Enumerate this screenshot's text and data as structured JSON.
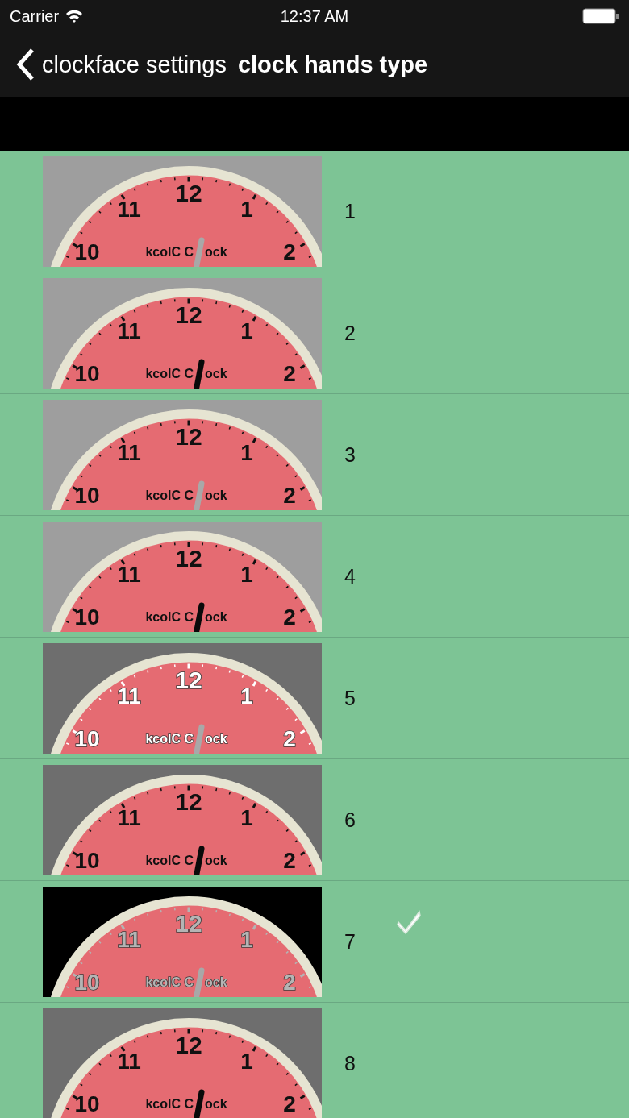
{
  "status_bar": {
    "carrier": "Carrier",
    "time": "12:37 AM"
  },
  "nav_bar": {
    "back_label": "clockface settings",
    "title": "clock hands type"
  },
  "rows": [
    {
      "label": "1",
      "selected": false,
      "color": "#9e9e9e",
      "kind": "silver",
      "numerals": {
        "color": "#111111",
        "labels": [
          "12",
          "11",
          "1",
          "10",
          "2"
        ]
      },
      "brand": [
        "kcolC C",
        "ock"
      ]
    },
    {
      "label": "2",
      "selected": false,
      "color": "#9e9e9e",
      "kind": "black",
      "numerals": {
        "color": "#111111",
        "labels": [
          "12",
          "11",
          "1",
          "10",
          "2"
        ]
      },
      "brand": [
        "kcolC C",
        "ock"
      ]
    },
    {
      "label": "3",
      "selected": false,
      "color": "#9e9e9e",
      "kind": "silver",
      "numerals": {
        "color": "#111111",
        "labels": [
          "12",
          "11",
          "1",
          "10",
          "2"
        ]
      },
      "brand": [
        "kcolC C",
        "ock"
      ]
    },
    {
      "label": "4",
      "selected": false,
      "color": "#9e9e9e",
      "kind": "black",
      "numerals": {
        "color": "#111111",
        "labels": [
          "12",
          "11",
          "1",
          "10",
          "2"
        ]
      },
      "brand": [
        "kcolC C",
        "ock"
      ]
    },
    {
      "label": "5",
      "selected": false,
      "color": "#6e6e6e",
      "kind": "silver",
      "numerals": {
        "color": "#ffffff",
        "labels": [
          "12",
          "11",
          "1",
          "10",
          "2"
        ]
      },
      "brand": [
        "kcolC C",
        "ock"
      ]
    },
    {
      "label": "6",
      "selected": false,
      "color": "#6e6e6e",
      "kind": "black",
      "numerals": {
        "color": "#111111",
        "labels": [
          "12",
          "11",
          "1",
          "10",
          "2"
        ]
      },
      "brand": [
        "kcolC C",
        "ock"
      ]
    },
    {
      "label": "7",
      "selected": true,
      "color": "#000000",
      "kind": "silver",
      "numerals": {
        "color": "#b4b4b4",
        "labels": [
          "12",
          "11",
          "1",
          "10",
          "2"
        ]
      },
      "brand": [
        "kcolC C",
        "ock"
      ]
    },
    {
      "label": "8",
      "selected": false,
      "color": "#6e6e6e",
      "kind": "black",
      "numerals": {
        "color": "#111111",
        "labels": [
          "12",
          "11",
          "1",
          "10",
          "2"
        ]
      },
      "brand": [
        "kcolC C",
        "ock"
      ]
    }
  ]
}
